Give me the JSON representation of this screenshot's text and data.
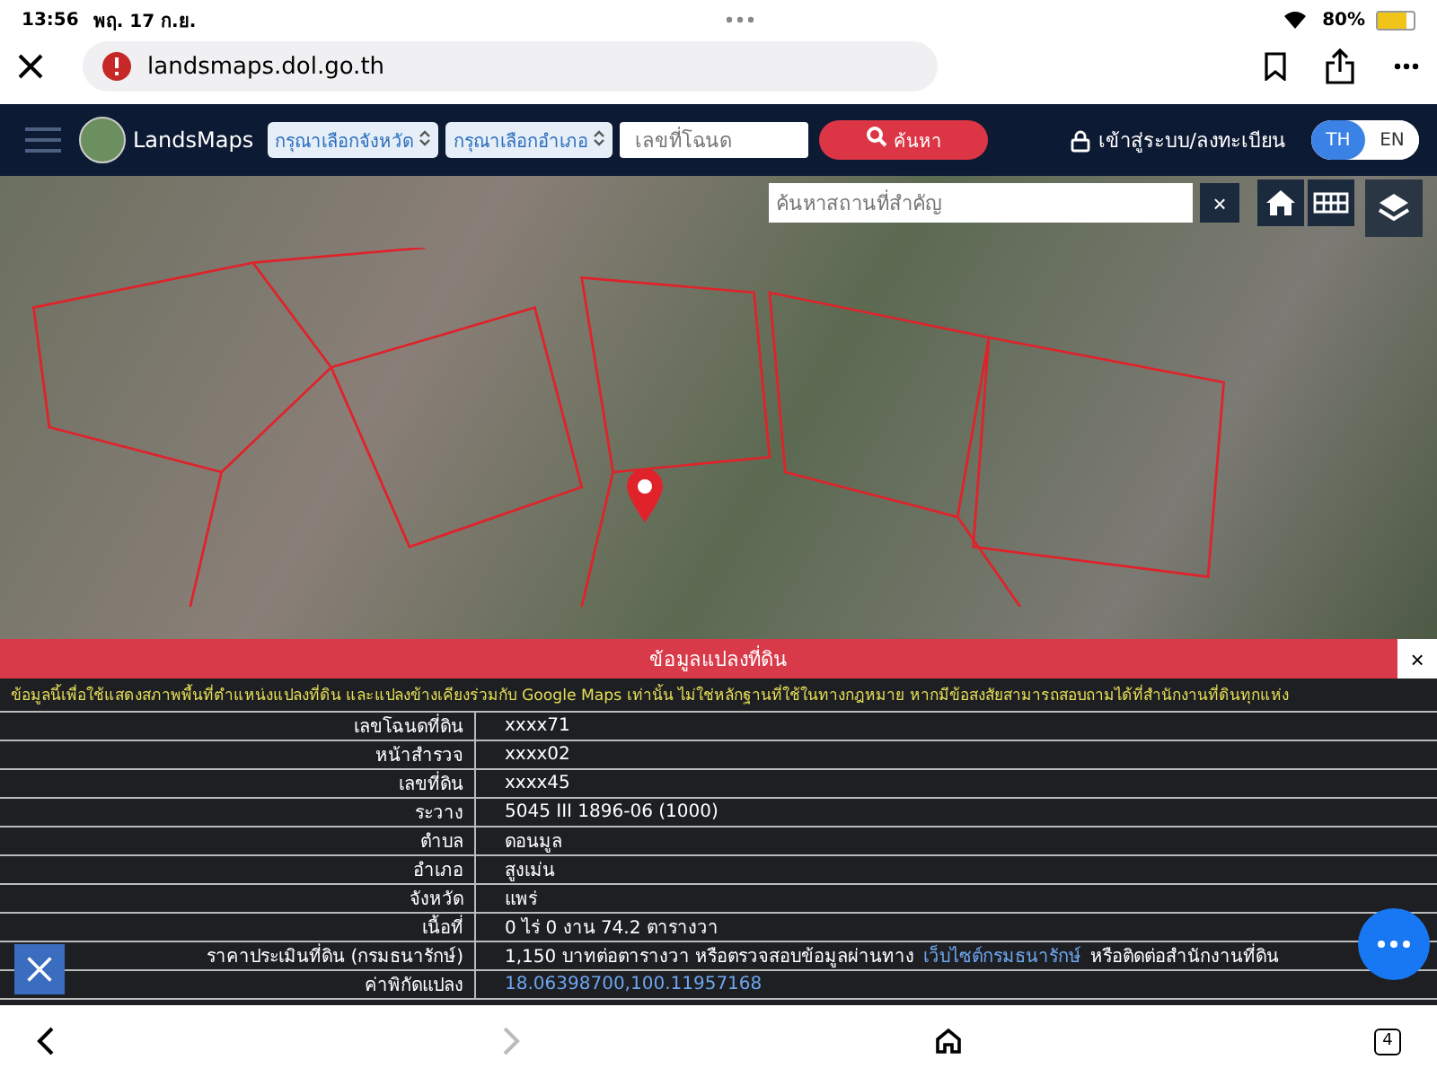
{
  "status_bar": {
    "time": "13:56",
    "date": "พฤ. 17 ก.ย.",
    "battery": "80%"
  },
  "browser": {
    "url": "landsmaps.dol.go.th"
  },
  "navbar": {
    "brand": "LandsMaps",
    "province_select": "กรุณาเลือกจังหวัด",
    "district_select": "กรุณาเลือกอำเภอ",
    "deed_field": {
      "placeholder": "เลขที่โฉนด"
    },
    "search_button": "ค้นหา",
    "login": "เข้าสู่ระบบ/ลงทะเบียน",
    "languages": [
      {
        "label": "TH",
        "selected": true
      },
      {
        "label": "EN",
        "selected": false
      }
    ]
  },
  "map": {
    "place_search": {
      "placeholder": "ค้นหาสถานที่สำคัญ"
    },
    "clear": "×"
  },
  "panel": {
    "title": "ข้อมูลแปลงที่ดิน",
    "close": "×",
    "notice": "ข้อมูลนี้เพื่อใช้แสดงสภาพพื้นที่ตำแหน่งแปลงที่ดิน และแปลงข้างเคียงร่วมกับ Google Maps เท่านั้น ไม่ใช่หลักฐานที่ใช้ในทางกฎหมาย หากมีข้อสงสัยสามารถสอบถามได้ที่สำนักงานที่ดินทุกแห่ง",
    "rows": [
      {
        "kind": "text",
        "label": "เลขโฉนดที่ดิน",
        "value": "xxxx71"
      },
      {
        "kind": "text",
        "label": "หน้าสำรวจ",
        "value": "xxxx02"
      },
      {
        "kind": "text",
        "label": "เลขที่ดิน",
        "value": "xxxx45"
      },
      {
        "kind": "text",
        "label": "ระวาง",
        "value": "5045 III 1896-06 (1000)"
      },
      {
        "kind": "text",
        "label": "ตำบล",
        "value": "ดอนมูล"
      },
      {
        "kind": "text",
        "label": "อำเภอ",
        "value": "สูงเม่น"
      },
      {
        "kind": "text",
        "label": "จังหวัด",
        "value": "แพร่"
      },
      {
        "kind": "text",
        "label": "เนื้อที่",
        "value": "0 ไร่ 0 งาน 74.2 ตารางวา"
      },
      {
        "kind": "mixed",
        "label": "ราคาประเมินที่ดิน (กรมธนารักษ์)",
        "value": "1,150 บาทต่อตารางวา หรือตรวจสอบข้อมูลผ่านทาง",
        "link": "เว็บไซต์กรมธนารักษ์",
        "after": "หรือติดต่อสำนักงานที่ดิน"
      },
      {
        "kind": "link",
        "label": "ค่าพิกัดแปลง",
        "value": "18.06398700,100.11957168"
      }
    ]
  },
  "bottom_bar": {
    "tab_count": "4"
  }
}
